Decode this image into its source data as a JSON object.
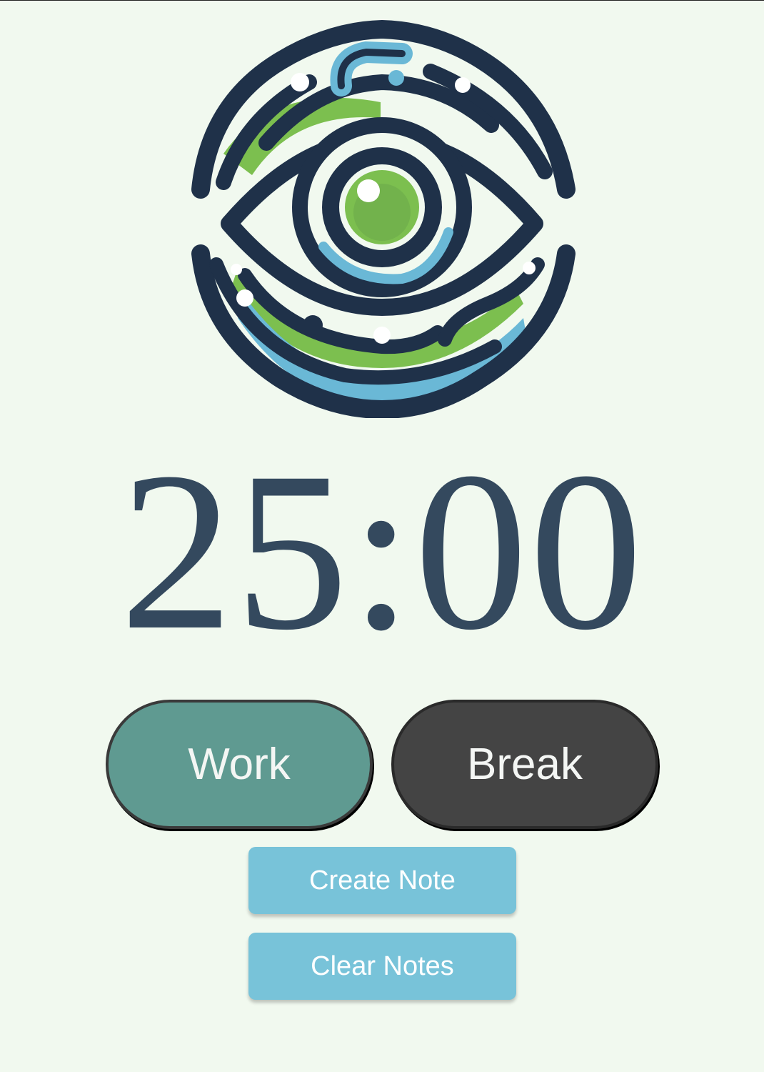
{
  "colors": {
    "background": "#f1f9ef",
    "timer_text": "#34495e",
    "work_button": "#5f9a91",
    "break_button": "#444444",
    "note_button": "#78c3d9",
    "logo_navy": "#1f3149",
    "logo_green": "#7cbf4f",
    "logo_blue": "#6ab8d6"
  },
  "logo": {
    "icon": "eye-logo-icon"
  },
  "timer": {
    "display": "25:00"
  },
  "modes": {
    "work_label": "Work",
    "break_label": "Break"
  },
  "notes": {
    "create_label": "Create Note",
    "clear_label": "Clear Notes"
  }
}
